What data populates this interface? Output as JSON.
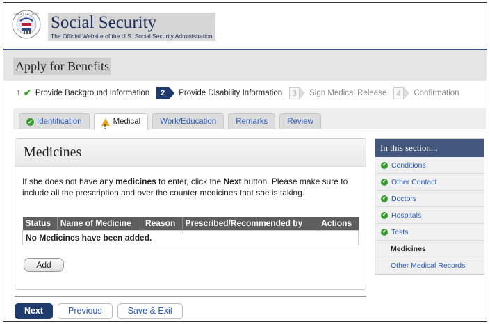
{
  "header": {
    "title": "Social Security",
    "subtitle": "The Official Website of the U.S. Social Security Administration",
    "seal_text": "SOCIAL SECURITY USA ADMINISTRATION"
  },
  "page_title": "Apply for Benefits",
  "steps": [
    {
      "num": "1",
      "label": "Provide Background Information",
      "state": "done"
    },
    {
      "num": "2",
      "label": "Provide Disability Information",
      "state": "active"
    },
    {
      "num": "3",
      "label": "Sign Medical Release",
      "state": "todo"
    },
    {
      "num": "4",
      "label": "Confirmation",
      "state": "todo"
    }
  ],
  "tabs": [
    {
      "label": "Identification",
      "icon": "check-circle-icon"
    },
    {
      "label": "Medical",
      "icon": "warning-icon"
    },
    {
      "label": "Work/Education"
    },
    {
      "label": "Remarks"
    },
    {
      "label": "Review"
    }
  ],
  "section": {
    "title": "Medicines",
    "intro_pre": "If she does not have any ",
    "intro_bold1": "medicines",
    "intro_mid": " to enter, click the ",
    "intro_bold2": "Next",
    "intro_post": " button. Please make sure to include all the prescription and over the counter medicines that she is taking."
  },
  "table": {
    "headers": [
      "Status",
      "Name of Medicine",
      "Reason",
      "Prescribed/Recommended by",
      "Actions"
    ],
    "empty_message": "No Medicines have been added."
  },
  "buttons": {
    "add": "Add",
    "next": "Next",
    "previous": "Previous",
    "save_exit": "Save & Exit"
  },
  "sidebar": {
    "title": "In this section...",
    "items": [
      {
        "label": "Conditions",
        "state": "complete"
      },
      {
        "label": "Other Contact",
        "state": "complete"
      },
      {
        "label": "Doctors",
        "state": "complete"
      },
      {
        "label": "Hospitals",
        "state": "complete"
      },
      {
        "label": "Tests",
        "state": "complete"
      },
      {
        "label": "Medicines",
        "state": "current"
      },
      {
        "label": "Other Medical Records",
        "state": "pending"
      }
    ]
  },
  "colors": {
    "navy": "#1f3b6b",
    "link": "#2a5bb8",
    "check_green": "#3a9b2e",
    "warning_orange": "#e7a325",
    "sidebar_header": "#44577f"
  }
}
